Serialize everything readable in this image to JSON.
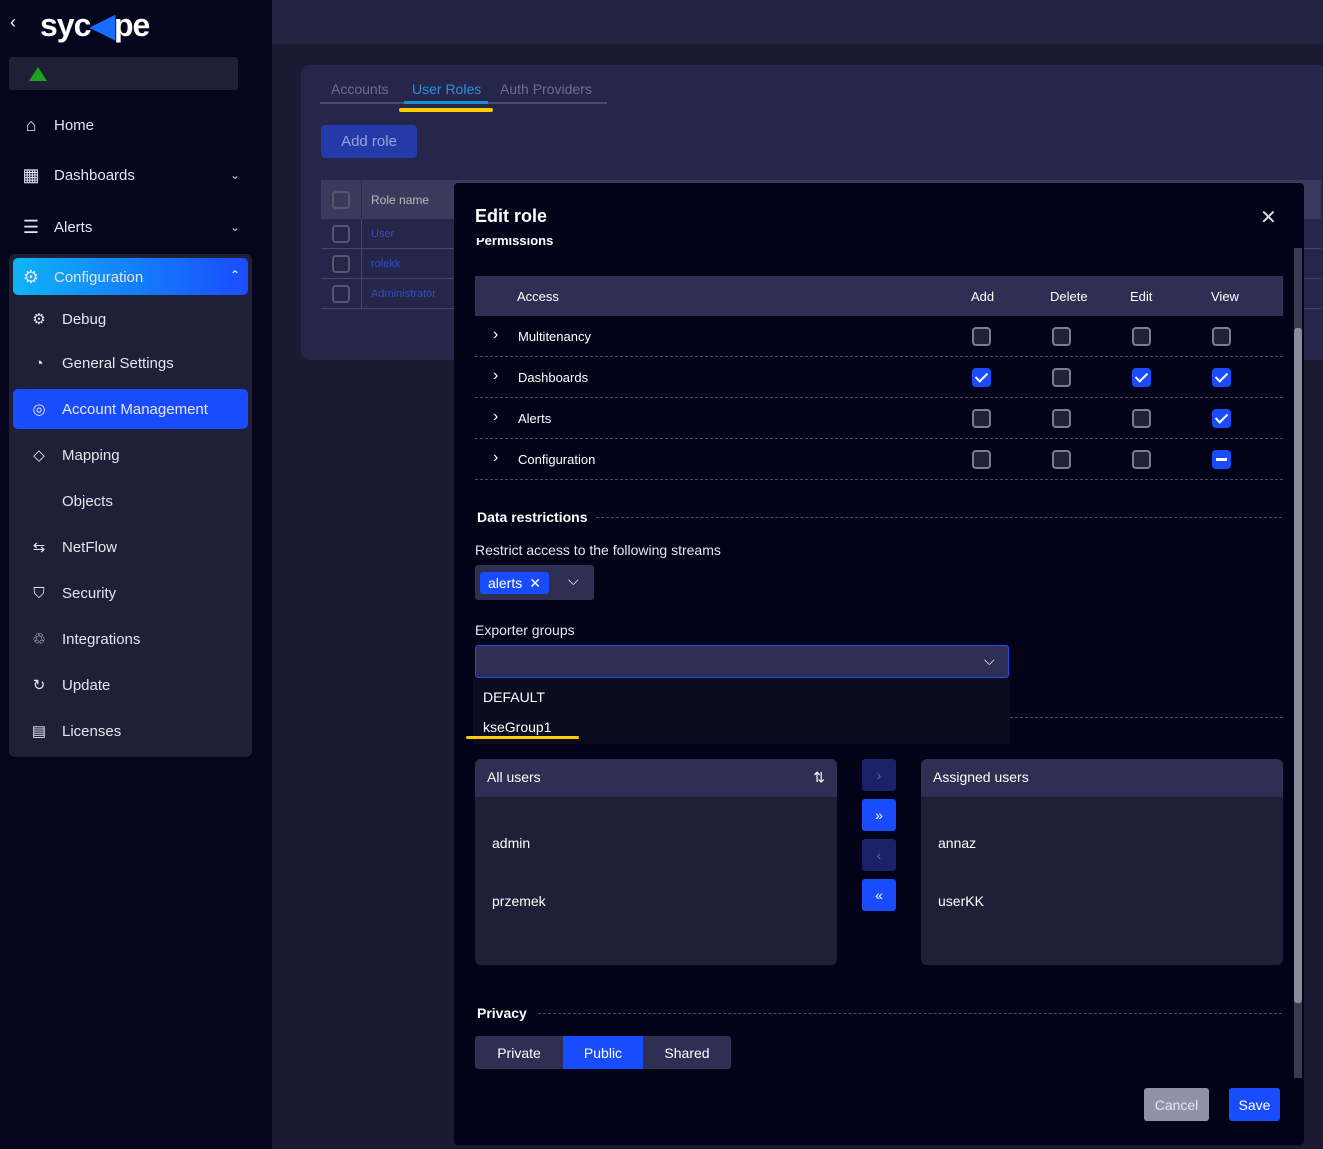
{
  "sidebar": {
    "logo": "sycope",
    "items": [
      {
        "label": "Home",
        "icon": "home-icon"
      },
      {
        "label": "Dashboards",
        "icon": "dashboards-icon"
      },
      {
        "label": "Alerts",
        "icon": "alerts-icon"
      },
      {
        "label": "Configuration",
        "icon": "gear-icon"
      },
      {
        "label": "Debug",
        "icon": "debug-icon"
      },
      {
        "label": "General Settings",
        "icon": "gauge-icon"
      },
      {
        "label": "Account Management",
        "icon": "user-circle-icon"
      },
      {
        "label": "Mapping",
        "icon": "tag-icon"
      },
      {
        "label": "Objects",
        "icon": "code-icon"
      },
      {
        "label": "NetFlow",
        "icon": "arrows-icon"
      },
      {
        "label": "Security",
        "icon": "shield-icon"
      },
      {
        "label": "Integrations",
        "icon": "puzzle-icon"
      },
      {
        "label": "Update",
        "icon": "refresh-icon"
      },
      {
        "label": "Licenses",
        "icon": "license-icon"
      }
    ]
  },
  "tabs": [
    "Accounts",
    "User Roles",
    "Auth Providers"
  ],
  "add_role": "Add role",
  "table": {
    "header": "Role name",
    "rows": [
      "User",
      "rolekk",
      "Administrator"
    ]
  },
  "modal": {
    "title": "Edit role",
    "section_partial": "Permissions",
    "perm_headers": [
      "Access",
      "Add",
      "Delete",
      "Edit",
      "View"
    ],
    "perm_rows": [
      {
        "name": "Multitenancy",
        "values": [
          "off",
          "off",
          "off",
          "off"
        ]
      },
      {
        "name": "Dashboards",
        "values": [
          "on",
          "off",
          "on",
          "on"
        ]
      },
      {
        "name": "Alerts",
        "values": [
          "off",
          "off",
          "off",
          "on"
        ]
      },
      {
        "name": "Configuration",
        "values": [
          "off",
          "off",
          "off",
          "indeterminate"
        ]
      }
    ],
    "data_restrictions": "Data restrictions",
    "streams_label": "Restrict access to the following streams",
    "stream_tag": "alerts",
    "exporter_label": "Exporter groups",
    "exporter_options": [
      "DEFAULT",
      "kseGroup1"
    ],
    "all_users": {
      "title": "All users",
      "items": [
        "admin",
        "przemek"
      ]
    },
    "assigned_users": {
      "title": "Assigned users",
      "items": [
        "annaz",
        "userKK"
      ]
    },
    "privacy": "Privacy",
    "privacy_options": [
      "Private",
      "Public",
      "Shared"
    ],
    "privacy_selected": "Public",
    "cancel": "Cancel",
    "save": "Save"
  },
  "colors": {
    "accent": "#1a4cff",
    "highlight": "#ffcc00"
  }
}
